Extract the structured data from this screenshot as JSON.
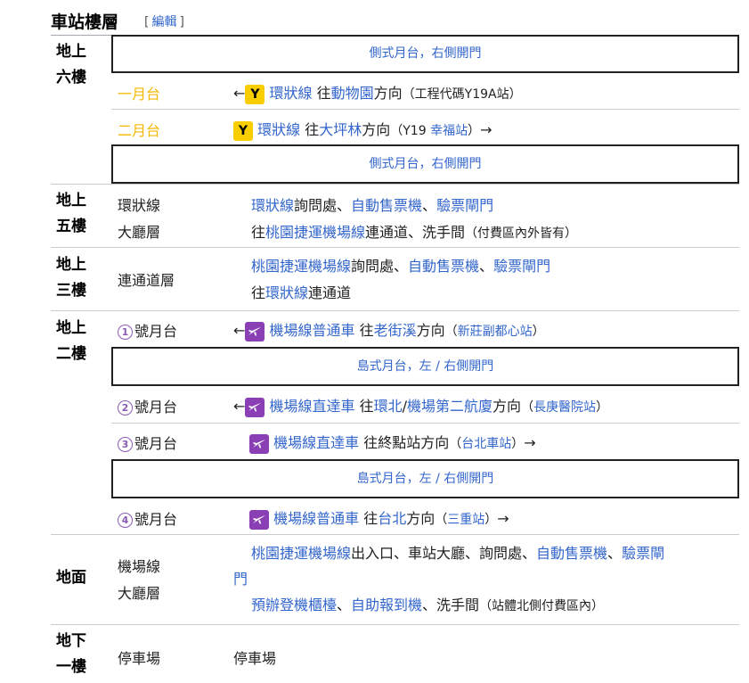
{
  "heading": {
    "title": "車站樓層",
    "edit_open": "[",
    "edit_label": "編輯",
    "edit_close": "]"
  },
  "colors": {
    "link": "#3366cc",
    "yellow_line": "#f8ce00",
    "airport_line": "#8a3fb5"
  },
  "icons": {
    "y_badge": "Y",
    "airport_badge": "plane-icon"
  },
  "floors": {
    "f6": {
      "name": [
        "地上",
        "六樓"
      ],
      "side_top": "側式月台，右側開門",
      "p1": {
        "label": "一月台",
        "arrow": "←",
        "line": "環狀線",
        "to": "往",
        "dest": "動物園",
        "dir": "方向",
        "note": "（工程代碼Y19A站）"
      },
      "p2": {
        "label": "二月台",
        "line": "環狀線",
        "to": "往",
        "dest": "大坪林",
        "dir": "方向",
        "note_open": "（Y19 ",
        "note_link": "幸福站",
        "note_close": "）",
        "arrow": "→"
      },
      "side_bottom": "側式月台，右側開門"
    },
    "f5": {
      "name": [
        "地上",
        "五樓"
      ],
      "label": [
        "環狀線",
        "大廳層"
      ],
      "line1": {
        "a": "環狀線",
        "b": "詢問處、",
        "c": "自動售票機",
        "d": "、",
        "e": "驗票閘門"
      },
      "line2": {
        "a": "往",
        "b": "桃園捷運機場線",
        "c": "連通道、洗手間",
        "d": "（付費區內外皆有）"
      }
    },
    "f3": {
      "name": [
        "地上",
        "三樓"
      ],
      "label": "連通道層",
      "line1": {
        "a": "桃園捷運機場線",
        "b": "詢問處、",
        "c": "自動售票機",
        "d": "、",
        "e": "驗票閘門"
      },
      "line2": {
        "a": "往",
        "b": "環狀線",
        "c": "連通道"
      }
    },
    "f2": {
      "name": [
        "地上",
        "二樓"
      ],
      "p1": {
        "num": "1",
        "label": "號月台",
        "arrow": "←",
        "line": "機場線普通車",
        "to": "往",
        "dest": "老街溪",
        "dir": "方向",
        "note_open": "（",
        "note_link": "新莊副都心站",
        "note_close": "）"
      },
      "island1": "島式月台，左 / 右側開門",
      "p2": {
        "num": "2",
        "label": "號月台",
        "arrow": "←",
        "line": "機場線直達車",
        "to": "往",
        "dest1": "環北",
        "slash": "/",
        "dest2": "機場第二航廈",
        "dir": "方向",
        "note_open": "（",
        "note_link": "長庚醫院站",
        "note_close": "）"
      },
      "p3": {
        "num": "3",
        "label": "號月台",
        "line": "機場線直達車",
        "to": "往終點站方向",
        "note_open": "（",
        "note_link": "台北車站",
        "note_close": "）",
        "arrow": "→"
      },
      "island2": "島式月台，左 / 右側開門",
      "p4": {
        "num": "4",
        "label": "號月台",
        "line": "機場線普通車",
        "to": "往",
        "dest": "台北",
        "dir": "方向",
        "note_open": "（",
        "note_link": "三重站",
        "note_close": "）",
        "arrow": "→"
      }
    },
    "gf": {
      "name": "地面",
      "label": [
        "機場線",
        "大廳層"
      ],
      "line1": {
        "a": "桃園捷運機場線",
        "b": "出入口、車站大廳、詢問處、",
        "c": "自動售票機",
        "d": "、",
        "e": "驗票閘",
        "f": "門"
      },
      "line2": {
        "a": "預辦登機櫃檯",
        "b": "、",
        "c": "自助報到機",
        "d": "、洗手間",
        "e": "（站體北側付費區內）"
      }
    },
    "b1": {
      "name": [
        "地下",
        "一樓"
      ],
      "label": "停車場",
      "content": "停車場"
    }
  }
}
